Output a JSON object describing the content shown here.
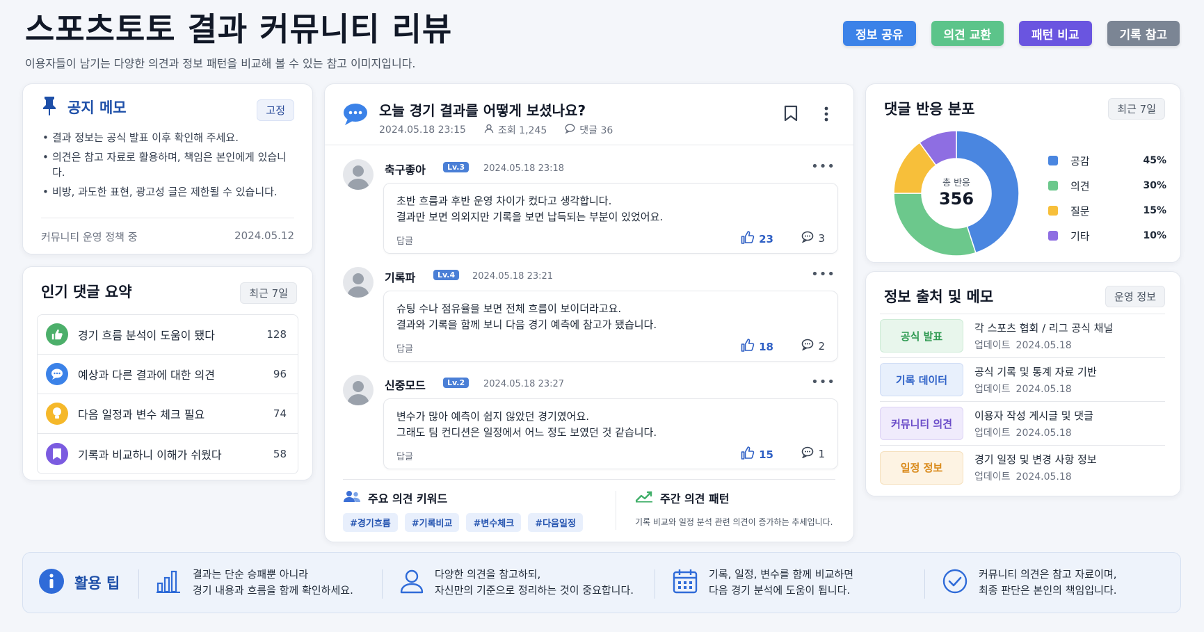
{
  "header": {
    "title": "스포츠토토 결과 커뮤니티 리뷰",
    "subtitle": "이용자들이 남기는 다양한 의견과 정보 패턴을 비교해 볼 수 있는 참고 이미지입니다.",
    "tags": [
      {
        "label": "정보 공유",
        "color": "#3b82e8"
      },
      {
        "label": "의견 교환",
        "color": "#5cc48a"
      },
      {
        "label": "패턴 비교",
        "color": "#6a55e0"
      },
      {
        "label": "기록 참고",
        "color": "#7b8594"
      }
    ]
  },
  "notice": {
    "title": "공지 메모",
    "pinned": "고정",
    "items": [
      "결과 정보는 공식 발표 이후 확인해 주세요.",
      "의견은 참고 자료로 활용하며, 책임은 본인에게 있습니다.",
      "비방, 과도한 표현, 광고성 글은 제한될 수 있습니다."
    ],
    "footer_label": "커뮤니티 운영 정책 중",
    "footer_date": "2024.05.12"
  },
  "popular": {
    "title": "인기 댓글 요약",
    "period": "최근 7일",
    "items": [
      {
        "icon": "thumbs-up-icon",
        "text": "경기 흐름 분석이 도움이 됐다",
        "count": "128",
        "color": "#4caf6a"
      },
      {
        "icon": "chat-icon",
        "text": "예상과 다른 결과에 대한 의견",
        "count": "96",
        "color": "#3b82e8"
      },
      {
        "icon": "lightbulb-icon",
        "text": "다음 일정과 변수 체크 필요",
        "count": "74",
        "color": "#f5b82a"
      },
      {
        "icon": "bookmark-icon",
        "text": "기록과 비교하니 이해가 쉬웠다",
        "count": "58",
        "color": "#7b5be0"
      }
    ]
  },
  "post": {
    "title": "오늘 경기 결과를 어떻게 보셨나요?",
    "date": "2024.05.18 23:15",
    "views": "조회 1,245",
    "comments": "댓글 36",
    "reply_label": "답글",
    "list": [
      {
        "name": "축구좋아",
        "level": "Lv.3",
        "date": "2024.05.18 23:18",
        "line1": "초반 흐름과 후반 운영 차이가 컸다고 생각합니다.",
        "line2": "결과만 보면 의외지만 기록을 보면 납득되는 부분이 있었어요.",
        "likes": "23",
        "replies": "3"
      },
      {
        "name": "기록파",
        "level": "Lv.4",
        "date": "2024.05.18 23:21",
        "line1": "슈팅 수나 점유율을 보면 전체 흐름이 보이더라고요.",
        "line2": "결과와 기록을 함께 보니 다음 경기 예측에 참고가 됐습니다.",
        "likes": "18",
        "replies": "2"
      },
      {
        "name": "신중모드",
        "level": "Lv.2",
        "date": "2024.05.18 23:27",
        "line1": "변수가 많아 예측이 쉽지 않았던 경기였어요.",
        "line2": "그래도 팀 컨디션은 일정에서 어느 정도 보였던 것 같습니다.",
        "likes": "15",
        "replies": "1"
      }
    ],
    "keywords_title": "주요 의견 키워드",
    "keywords": [
      "#경기흐름",
      "#기록비교",
      "#변수체크",
      "#다음일정"
    ],
    "pattern_title": "주간 의견 패턴",
    "pattern_desc": "기록 비교와 일정 분석 관련 의견이 증가하는 추세입니다."
  },
  "distribution": {
    "title": "댓글 반응 분포",
    "period": "최근 7일",
    "center_label": "총 반응",
    "center_value": "356",
    "slices": [
      {
        "label": "공감",
        "value": 45,
        "display": "45%",
        "color": "#4a86e0"
      },
      {
        "label": "의견",
        "value": 30,
        "display": "30%",
        "color": "#6cc88c"
      },
      {
        "label": "질문",
        "value": 15,
        "display": "15%",
        "color": "#f7bf3a"
      },
      {
        "label": "기타",
        "value": 10,
        "display": "10%",
        "color": "#8e6ee2"
      }
    ]
  },
  "sources": {
    "title": "정보 출처 및 메모",
    "pill": "운영 정보",
    "update_label": "업데이트",
    "rows": [
      {
        "badge": "공식 발표",
        "bg": "#e8f6ec",
        "fg": "#2f9a52",
        "border": "#cdebd6",
        "title": "각 스포츠 협회 / 리그 공식 채널",
        "date": "2024.05.18"
      },
      {
        "badge": "기록 데이터",
        "bg": "#e8f0fc",
        "fg": "#2f62c8",
        "border": "#cfdcf5",
        "title": "공식 기록 및 통계 자료 기반",
        "date": "2024.05.18"
      },
      {
        "badge": "커뮤니티 의견",
        "bg": "#f0ebfc",
        "fg": "#6a4bc8",
        "border": "#ddd3f5",
        "title": "이용자 작성 게시글 및 댓글",
        "date": "2024.05.18"
      },
      {
        "badge": "일정 정보",
        "bg": "#fdf3e3",
        "fg": "#d98a1a",
        "border": "#f5e0bd",
        "title": "경기 일정 및 변경 사항 정보",
        "date": "2024.05.18"
      }
    ]
  },
  "tips": {
    "title": "활용 팁",
    "items": [
      {
        "icon": "bar-chart-icon",
        "line1": "결과는 단순 승패뿐 아니라",
        "line2": "경기 내용과 흐름을 함께 확인하세요."
      },
      {
        "icon": "user-icon",
        "line1": "다양한 의견을 참고하되,",
        "line2": "자신만의 기준으로 정리하는 것이 중요합니다."
      },
      {
        "icon": "calendar-icon",
        "line1": "기록, 일정, 변수를 함께 비교하면",
        "line2": "다음 경기 분석에 도움이 됩니다."
      },
      {
        "icon": "check-circle-icon",
        "line1": "커뮤니티 의견은 참고 자료이며,",
        "line2": "최종 판단은 본인의 책임입니다."
      }
    ]
  }
}
